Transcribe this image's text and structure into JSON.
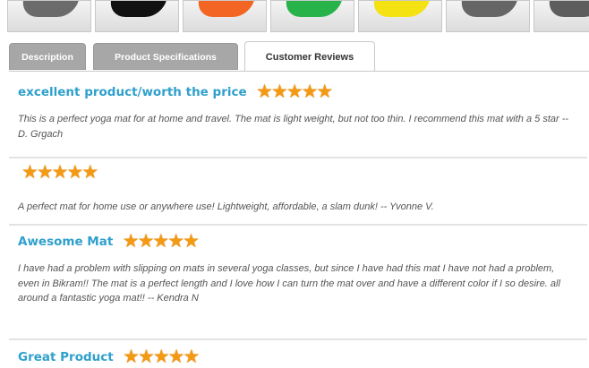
{
  "product_thumbnails": [
    {
      "name": "gray-mat-thumbnail",
      "color": "#6b6b6b"
    },
    {
      "name": "black-mat-thumbnail",
      "color": "#111111"
    },
    {
      "name": "orange-mat-thumbnail",
      "color": "#f26522"
    },
    {
      "name": "green-mat-thumbnail",
      "color": "#27b24a"
    },
    {
      "name": "yellow-mat-thumbnail",
      "color": "#f5e213"
    },
    {
      "name": "gray-mat-thumbnail",
      "color": "#666666"
    },
    {
      "name": "gray-mat-thumbnail",
      "color": "#5d5d5d"
    }
  ],
  "tabs": [
    {
      "label": "Description",
      "active": false
    },
    {
      "label": "Product Specifications",
      "active": false
    },
    {
      "label": "Customer Reviews",
      "active": true
    }
  ],
  "reviews": [
    {
      "title": "excellent product/worth the price",
      "rating": 5,
      "body": "This is a perfect yoga mat for at home and travel. The mat is light weight, but not too thin. I recommend this mat with a 5 star  -- D. Grgach"
    },
    {
      "title": "",
      "rating": 5,
      "body": "A perfect mat for home use or anywhere use! Lightweight, affordable, a slam dunk! -- Yvonne V."
    },
    {
      "title": "Awesome Mat",
      "rating": 5,
      "body": "I have had a problem with slipping on mats in several yoga classes, but since I have had this mat I have not had a problem, even in Bikram!! The mat is a perfect length and I love how I can turn the mat over and have a different color if I so desire. all around a fantastic yoga mat!! -- Kendra N"
    },
    {
      "title": "Great Product",
      "rating": 5,
      "body": ""
    }
  ],
  "colors": {
    "accent": "#2fa0cc",
    "star": "#f39a12",
    "tab_inactive": "#a7a7a7"
  },
  "icons": {
    "rating": "star-icon"
  }
}
